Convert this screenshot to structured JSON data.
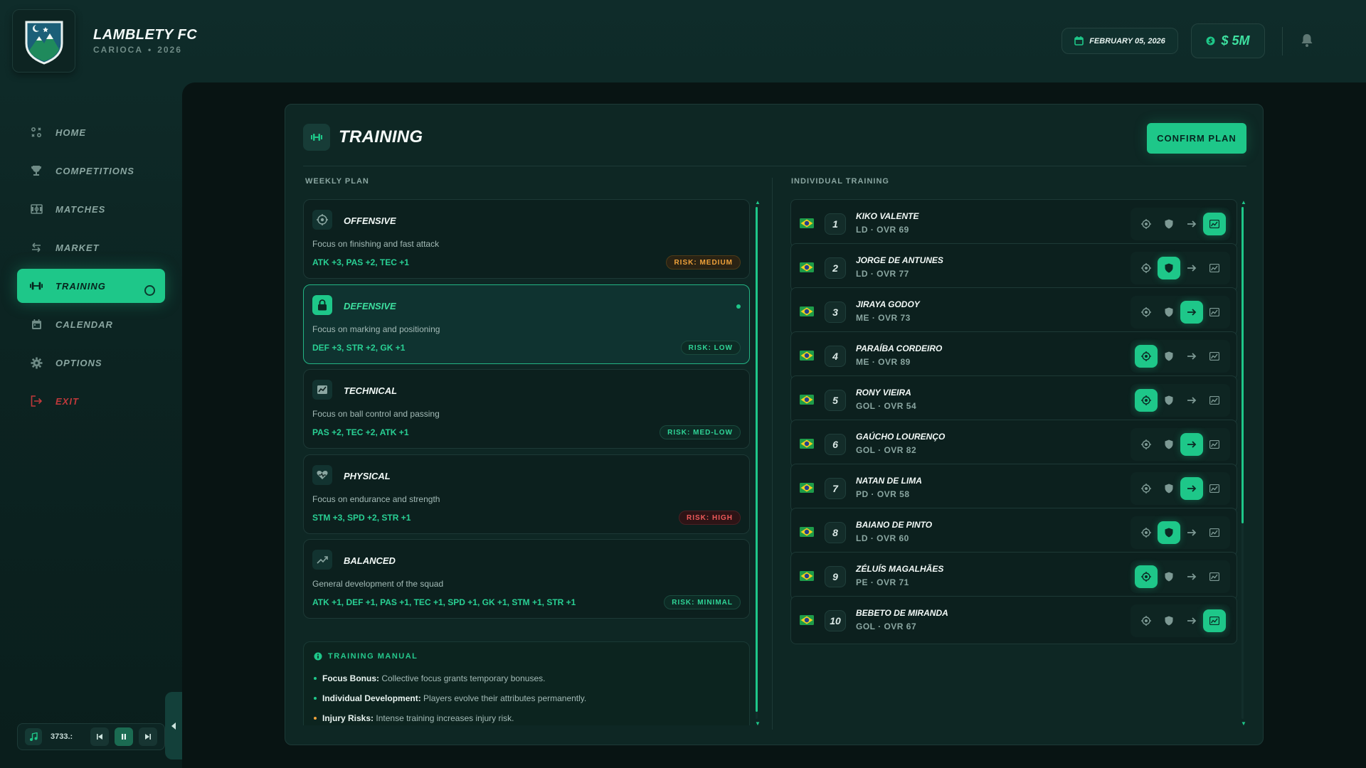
{
  "club": {
    "name": "LAMBLETY FC",
    "league": "CARIOCA",
    "dot": "•",
    "season": "2026",
    "logo_icon": "shield-mountain-moon-crest"
  },
  "header": {
    "date": "FEBRUARY 05, 2026",
    "money": "$ 5M"
  },
  "sidebar": {
    "items": [
      {
        "label": "HOME",
        "icon": "home-icon"
      },
      {
        "label": "COMPETITIONS",
        "icon": "trophy-icon"
      },
      {
        "label": "MATCHES",
        "icon": "field-icon"
      },
      {
        "label": "MARKET",
        "icon": "transfer-icon"
      },
      {
        "label": "TRAINING",
        "icon": "dumbbell-icon",
        "active": true
      },
      {
        "label": "CALENDAR",
        "icon": "calendar-icon"
      },
      {
        "label": "OPTIONS",
        "icon": "gear-icon"
      },
      {
        "label": "EXIT",
        "icon": "logout-icon"
      }
    ]
  },
  "music": {
    "time": "3733.:"
  },
  "training": {
    "title": "TRAINING",
    "confirm_label": "CONFIRM PLAN",
    "weekly_label": "WEEKLY PLAN",
    "individual_label": "INDIVIDUAL TRAINING",
    "plans": [
      {
        "name": "OFFENSIVE",
        "desc": "Focus on finishing and fast attack",
        "stats": "ATK +3, PAS +2, TEC +1",
        "risk": "RISK: MEDIUM",
        "risk_level": "medium",
        "icon": "target-icon"
      },
      {
        "name": "DEFENSIVE",
        "desc": "Focus on marking and positioning",
        "stats": "DEF +3, STR +2, GK +1",
        "risk": "RISK: LOW",
        "risk_level": "low",
        "icon": "lock-icon",
        "selected": true
      },
      {
        "name": "TECHNICAL",
        "desc": "Focus on ball control and passing",
        "stats": "PAS +2, TEC +2, ATK +1",
        "risk": "RISK: MED-LOW",
        "risk_level": "medlow",
        "icon": "chart-icon"
      },
      {
        "name": "PHYSICAL",
        "desc": "Focus on endurance and strength",
        "stats": "STM +3, SPD +2, STR +1",
        "risk": "RISK: HIGH",
        "risk_level": "high",
        "icon": "heart-icon"
      },
      {
        "name": "BALANCED",
        "desc": "General development of the squad",
        "stats": "ATK +1, DEF +1, PAS +1, TEC +1, SPD +1, GK +1, STM +1, STR +1",
        "risk": "RISK: MINIMAL",
        "risk_level": "minimal",
        "icon": "trend-icon"
      }
    ],
    "manual": {
      "title": "TRAINING MANUAL",
      "items": [
        {
          "bold": "Focus Bonus:",
          "text": "Collective focus grants temporary bonuses."
        },
        {
          "bold": "Individual Development:",
          "text": "Players evolve their attributes permanently."
        },
        {
          "bold": "Injury Risks:",
          "text": "Intense training increases injury risk."
        }
      ]
    },
    "players": [
      {
        "num": "1",
        "name": "KIKO VALENTE",
        "meta": "LD · OVR 69",
        "focus": 3
      },
      {
        "num": "2",
        "name": "JORGE DE ANTUNES",
        "meta": "LD · OVR 77",
        "focus": 1
      },
      {
        "num": "3",
        "name": "JIRAYA GODOY",
        "meta": "ME · OVR 73",
        "focus": 2
      },
      {
        "num": "4",
        "name": "PARAÍBA CORDEIRO",
        "meta": "ME · OVR 89",
        "focus": 0
      },
      {
        "num": "5",
        "name": "RONY VIEIRA",
        "meta": "GOL · OVR 54",
        "focus": 0
      },
      {
        "num": "6",
        "name": "GAÚCHO LOURENÇO",
        "meta": "GOL · OVR 82",
        "focus": 2
      },
      {
        "num": "7",
        "name": "NATAN DE LIMA",
        "meta": "PD · OVR 58",
        "focus": 2
      },
      {
        "num": "8",
        "name": "BAIANO DE PINTO",
        "meta": "LD · OVR 60",
        "focus": 1
      },
      {
        "num": "9",
        "name": "ZÉLUÍS MAGALHÃES",
        "meta": "PE · OVR 71",
        "focus": 0
      },
      {
        "num": "10",
        "name": "BEBETO DE MIRANDA",
        "meta": "GOL · OVR 67",
        "focus": 3
      }
    ],
    "focus_icons": [
      "target-icon",
      "shield-icon",
      "arrow-right-icon",
      "chart-icon"
    ]
  },
  "colors": {
    "accent": "#1ec789",
    "risk_medium": "#f0a23a",
    "risk_high": "#ee5a5a",
    "exit": "#c0393b"
  }
}
